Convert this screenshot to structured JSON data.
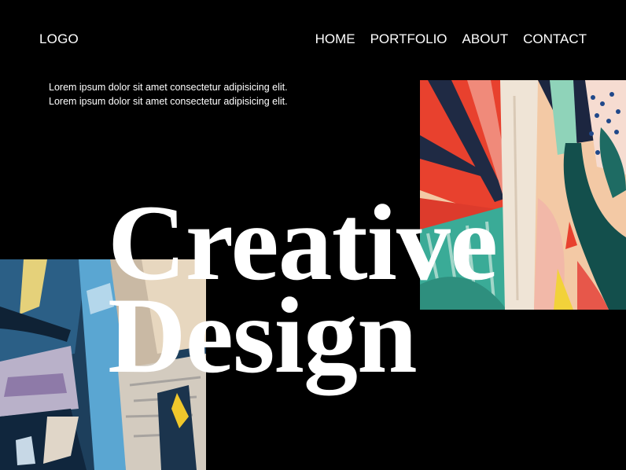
{
  "header": {
    "logo": "LOGO",
    "nav": [
      "HOME",
      "PORTFOLIO",
      "ABOUT",
      "CONTACT"
    ]
  },
  "intro": {
    "line1": "Lorem ipsum dolor sit amet consectetur adipisicing elit.",
    "line2": "Lorem ipsum dolor sit amet consectetur adipisicing elit."
  },
  "hero": {
    "line1": "Creative",
    "line2": "Design"
  },
  "colors": {
    "background": "#000000",
    "text": "#ffffff"
  }
}
